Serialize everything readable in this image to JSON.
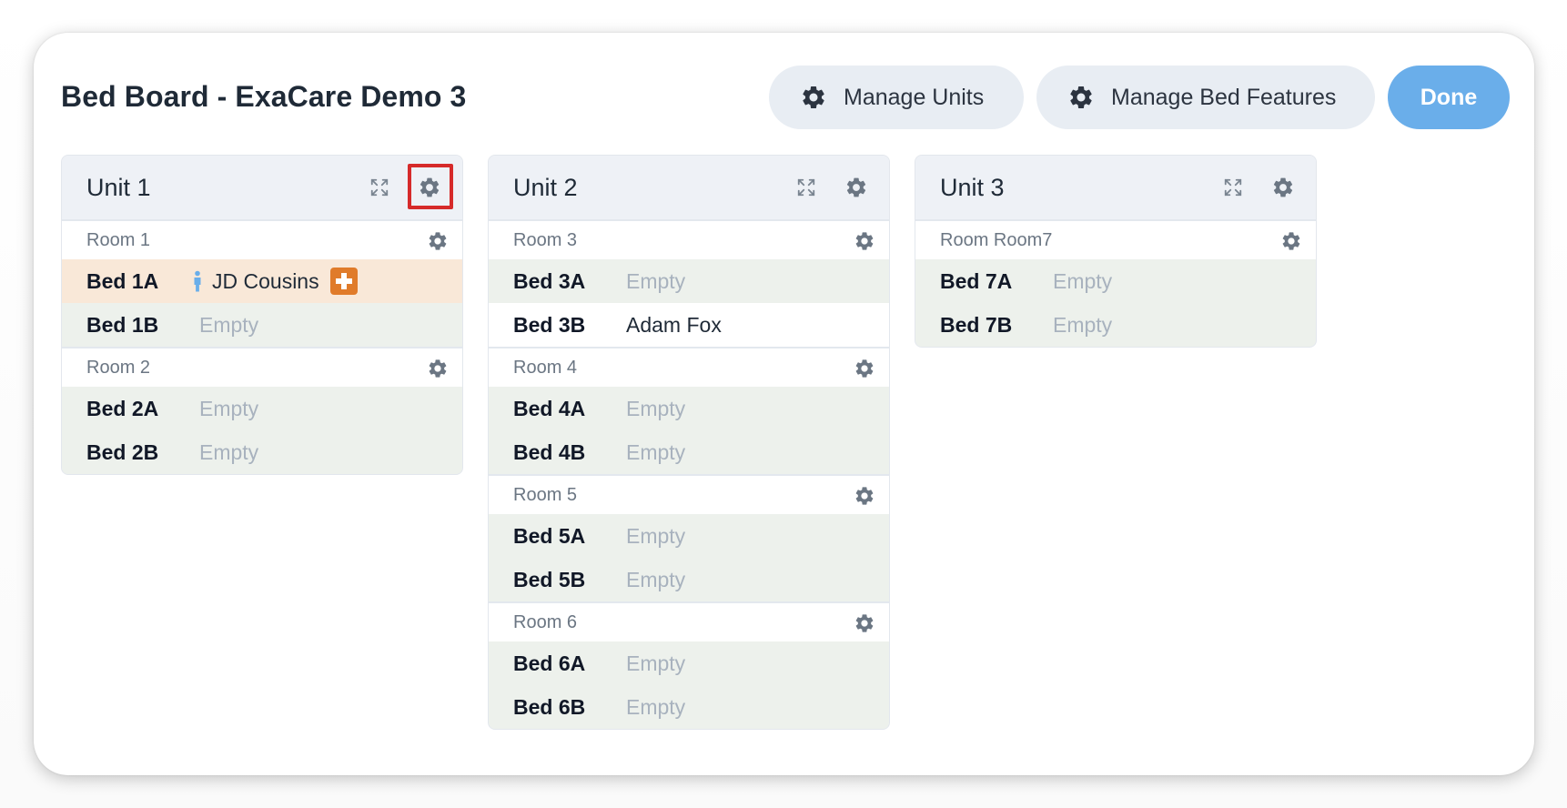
{
  "header": {
    "title": "Bed Board - ExaCare Demo 3",
    "manage_units": "Manage Units",
    "manage_bed_features": "Manage Bed Features",
    "done": "Done"
  },
  "colors": {
    "primary": "#6aaeea",
    "highlight": "#d62a2a",
    "alert_row": "#f9e8d8",
    "empty_row": "#edf1ec",
    "medical_badge": "#e07b2a"
  },
  "units": [
    {
      "name": "Unit 1",
      "rooms": [
        {
          "name": "Room 1",
          "beds": [
            {
              "name": "Bed 1A",
              "status": "JD Cousins"
            },
            {
              "name": "Bed 1B",
              "status": "Empty"
            }
          ]
        },
        {
          "name": "Room 2",
          "beds": [
            {
              "name": "Bed 2A",
              "status": "Empty"
            },
            {
              "name": "Bed 2B",
              "status": "Empty"
            }
          ]
        }
      ]
    },
    {
      "name": "Unit 2",
      "rooms": [
        {
          "name": "Room 3",
          "beds": [
            {
              "name": "Bed 3A",
              "status": "Empty"
            },
            {
              "name": "Bed 3B",
              "status": "Adam Fox"
            }
          ]
        },
        {
          "name": "Room 4",
          "beds": [
            {
              "name": "Bed 4A",
              "status": "Empty"
            },
            {
              "name": "Bed 4B",
              "status": "Empty"
            }
          ]
        },
        {
          "name": "Room 5",
          "beds": [
            {
              "name": "Bed 5A",
              "status": "Empty"
            },
            {
              "name": "Bed 5B",
              "status": "Empty"
            }
          ]
        },
        {
          "name": "Room 6",
          "beds": [
            {
              "name": "Bed 6A",
              "status": "Empty"
            },
            {
              "name": "Bed 6B",
              "status": "Empty"
            }
          ]
        }
      ]
    },
    {
      "name": "Unit 3",
      "rooms": [
        {
          "name": "Room Room7",
          "beds": [
            {
              "name": "Bed 7A",
              "status": "Empty"
            },
            {
              "name": "Bed 7B",
              "status": "Empty"
            }
          ]
        }
      ]
    }
  ]
}
